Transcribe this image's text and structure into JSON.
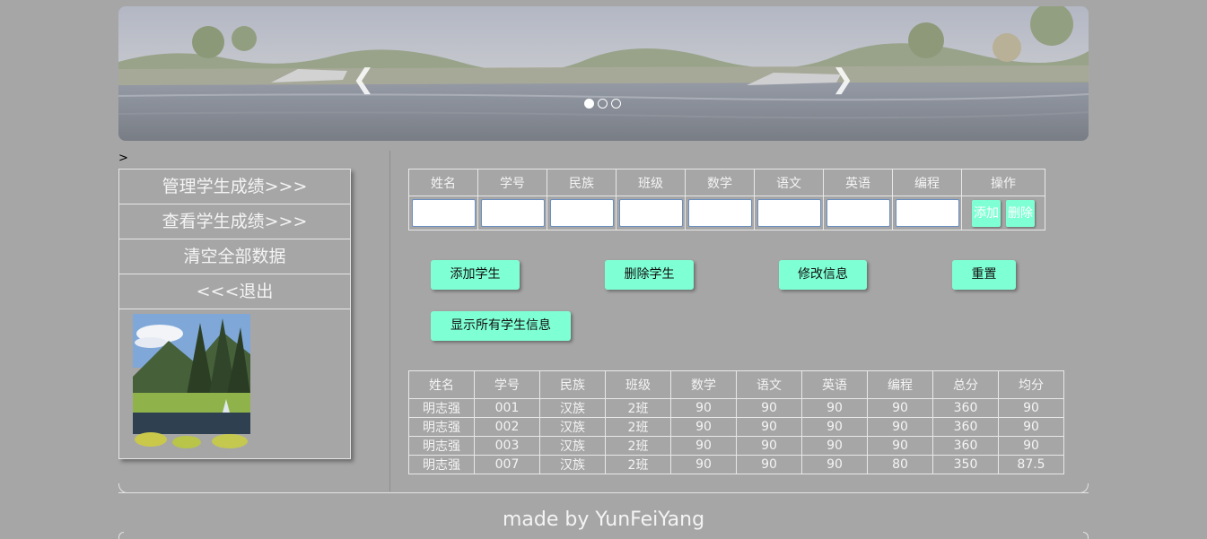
{
  "banner": {
    "prev_icon": "chevron-left-icon",
    "next_icon": "chevron-right-icon",
    "prev_glyph": "❮",
    "next_glyph": "❯",
    "slide_count": 3,
    "active_slide": 1
  },
  "stray_text": ">",
  "sidebar": {
    "items": [
      {
        "label": "管理学生成绩>>>"
      },
      {
        "label": "查看学生成绩>>>"
      },
      {
        "label": "清空全部数据"
      },
      {
        "label": "<<<退出"
      }
    ]
  },
  "input_table": {
    "headers": [
      "姓名",
      "学号",
      "民族",
      "班级",
      "数学",
      "语文",
      "英语",
      "编程",
      "操作"
    ],
    "add_label": "添加",
    "delete_label": "删除"
  },
  "actions": {
    "add_student": "添加学生",
    "delete_student": "删除学生",
    "modify_info": "修改信息",
    "reset": "重置",
    "show_all": "显示所有学生信息"
  },
  "data_table": {
    "headers": [
      "姓名",
      "学号",
      "民族",
      "班级",
      "数学",
      "语文",
      "英语",
      "编程",
      "总分",
      "均分"
    ],
    "rows": [
      [
        "明志强",
        "001",
        "汉族",
        "2班",
        "90",
        "90",
        "90",
        "90",
        "360",
        "90"
      ],
      [
        "明志强",
        "002",
        "汉族",
        "2班",
        "90",
        "90",
        "90",
        "90",
        "360",
        "90"
      ],
      [
        "明志强",
        "003",
        "汉族",
        "2班",
        "90",
        "90",
        "90",
        "90",
        "360",
        "90"
      ],
      [
        "明志强",
        "007",
        "汉族",
        "2班",
        "90",
        "90",
        "90",
        "80",
        "350",
        "87.5"
      ]
    ]
  },
  "footer": "made by YunFeiYang",
  "colors": {
    "page_bg": "#a6a6a6",
    "accent_button": "#7fffd4",
    "border": "#e8e8e8"
  }
}
